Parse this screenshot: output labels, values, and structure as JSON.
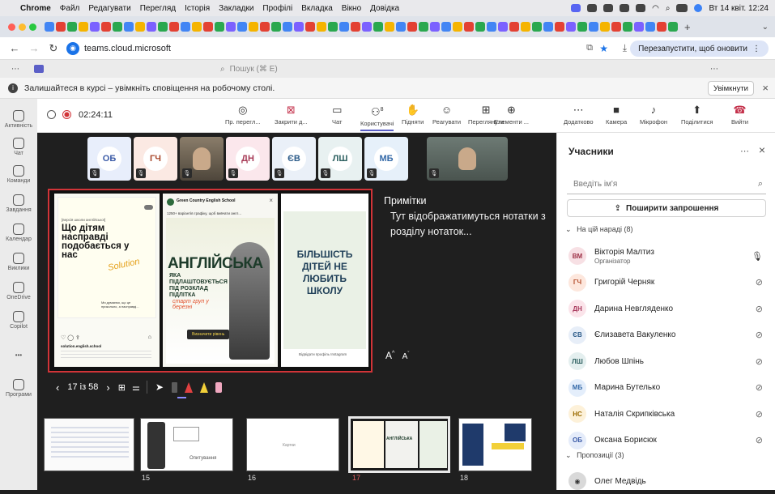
{
  "os_menubar": {
    "app": "Chrome",
    "menus": [
      "Файл",
      "Редагувати",
      "Перегляд",
      "Історія",
      "Закладки",
      "Профілі",
      "Вкладка",
      "Вікно",
      "Довідка"
    ],
    "datetime": "Вт 14 квіт. 12:24"
  },
  "browser": {
    "url": "teams.cloud.microsoft",
    "relaunch_label": "Перезапустити, щоб оновити"
  },
  "teams": {
    "search_placeholder": "Пошук (⌘ E)",
    "notification_text": "Залишайтеся в курсі – увімкніть сповіщення на робочому столі.",
    "notification_button": "Увімкнути"
  },
  "rail": [
    {
      "label": "Активність",
      "icon": "bell-icon"
    },
    {
      "label": "Чат",
      "icon": "chat-icon"
    },
    {
      "label": "Команди",
      "icon": "teams-icon"
    },
    {
      "label": "Завдання",
      "icon": "tasks-icon"
    },
    {
      "label": "Календар",
      "icon": "calendar-icon"
    },
    {
      "label": "Виклики",
      "icon": "phone-icon"
    },
    {
      "label": "OneDrive",
      "icon": "onedrive-icon"
    },
    {
      "label": "Copilot",
      "icon": "copilot-icon"
    },
    {
      "label": "...",
      "icon": "more-icon"
    },
    {
      "label": "Програми",
      "icon": "apps-icon"
    }
  ],
  "meeting": {
    "timer": "02:24:11",
    "tools": [
      {
        "label": "Пр. перегл...",
        "icon": "broadcast-icon"
      },
      {
        "label": "Закрити д...",
        "icon": "close-share-icon"
      },
      {
        "label": "Чат",
        "icon": "chat-icon"
      },
      {
        "label": "Користувачі",
        "icon": "people-icon",
        "badge": "8"
      },
      {
        "label": "Підняти",
        "icon": "raise-hand-icon"
      },
      {
        "label": "Реагувати",
        "icon": "react-icon"
      },
      {
        "label": "Переглянути",
        "icon": "view-icon"
      },
      {
        "label": "Елементи ...",
        "icon": "apps-icon"
      },
      {
        "label": "Додатково",
        "icon": "more-icon"
      },
      {
        "label": "Камера",
        "icon": "camera-icon"
      },
      {
        "label": "Мікрофон",
        "icon": "mic-icon"
      },
      {
        "label": "Поділитися",
        "icon": "share-icon"
      },
      {
        "label": "Вийти",
        "icon": "leave-icon"
      }
    ]
  },
  "gallery": [
    {
      "initials": "ОБ",
      "bg": "#e8eefb",
      "fg": "#3b5ba7"
    },
    {
      "initials": "ГЧ",
      "bg": "#fbe9e3",
      "fg": "#a8462a"
    },
    {
      "initials": "",
      "photo": true
    },
    {
      "initials": "ДН",
      "bg": "#fbe7ec",
      "fg": "#a73b57"
    },
    {
      "initials": "ЄВ",
      "bg": "#eaf0f8",
      "fg": "#2e5d8a"
    },
    {
      "initials": "ЛШ",
      "bg": "#e8f1f1",
      "fg": "#2c5f5f"
    },
    {
      "initials": "МБ",
      "bg": "#e6f0fa",
      "fg": "#356aa8"
    },
    {
      "initials": "",
      "photo": true
    }
  ],
  "slide": {
    "card1": {
      "small": "[версія школи англійської]",
      "title": "Що дітям насправді подобається у нас",
      "script": "Solution",
      "note": "Ми думаємо, що це прикольно, а насправді...",
      "handle": "solution.english.school"
    },
    "card2": {
      "school": "Green Country English School",
      "sub": "1250+ варіантів графіку, щоб вивчати англ...",
      "big": "АНГЛІЙСЬКА",
      "tag": "ЯКА ПІДЛАШТОВУЄТЬСЯ ПІД РОЗКЛАД ПІДЛІТКА",
      "script": "старт груп у березні",
      "cta": "Визначити рівень"
    },
    "card3": {
      "text": "БІЛЬШІСТЬ ДІТЕЙ НЕ ЛЮБИТЬ ШКОЛУ",
      "link": "Відвідати профіль Instagram"
    }
  },
  "notes": {
    "title": "Примітки",
    "body": "Тут відображатимуться нотатки з розділу нотаток...",
    "font_up": "A",
    "font_down": "A"
  },
  "slide_nav": {
    "page": "17 із 58"
  },
  "thumbnails": [
    {
      "num": "",
      "label": ""
    },
    {
      "num": "15",
      "label": "Опитування"
    },
    {
      "num": "16",
      "label": "Картки"
    },
    {
      "num": "17",
      "label": "",
      "active": true
    },
    {
      "num": "18",
      "label": ""
    }
  ],
  "participants_panel": {
    "title": "Учасники",
    "search_placeholder": "Введіть ім'я",
    "invite_label": "Поширити запрошення",
    "group_label": "На цій нараді (8)",
    "suggestions_label": "Пропозиції (3)",
    "people": [
      {
        "initials": "ВМ",
        "name": "Вікторія Малтиз",
        "role": "Організатор",
        "bg": "#f7e0e4",
        "fg": "#9c2f45",
        "mic": "on"
      },
      {
        "initials": "ГЧ",
        "name": "Григорій Черняк",
        "role": "",
        "bg": "#fde7dd",
        "fg": "#b5502f",
        "mic": "off"
      },
      {
        "initials": "ДН",
        "name": "Дарина Невгляденко",
        "role": "",
        "bg": "#fbe4ea",
        "fg": "#a6365a",
        "mic": "off"
      },
      {
        "initials": "ЄВ",
        "name": "Єлизавета Вакуленко",
        "role": "",
        "bg": "#e7eef8",
        "fg": "#2e5d8a",
        "mic": "off"
      },
      {
        "initials": "ЛШ",
        "name": "Любов Шпінь",
        "role": "",
        "bg": "#e4efef",
        "fg": "#2c5f5f",
        "mic": "off"
      },
      {
        "initials": "МБ",
        "name": "Марина Бутелько",
        "role": "",
        "bg": "#e4eefb",
        "fg": "#356aa8",
        "mic": "off"
      },
      {
        "initials": "НС",
        "name": "Наталія Скрипківська",
        "role": "",
        "bg": "#fdf1d9",
        "fg": "#9a6a00",
        "mic": "off"
      },
      {
        "initials": "ОБ",
        "name": "Оксана Борисюк",
        "role": "",
        "bg": "#e5ecfa",
        "fg": "#3b5ba7",
        "mic": "off"
      }
    ],
    "suggested": [
      {
        "initials": "",
        "name": "Олег Медвідь"
      }
    ]
  },
  "colors": {
    "accent": "#5b5fc7",
    "leave": "#c4314b",
    "record": "#d13438",
    "slide_border": "#d13438"
  }
}
